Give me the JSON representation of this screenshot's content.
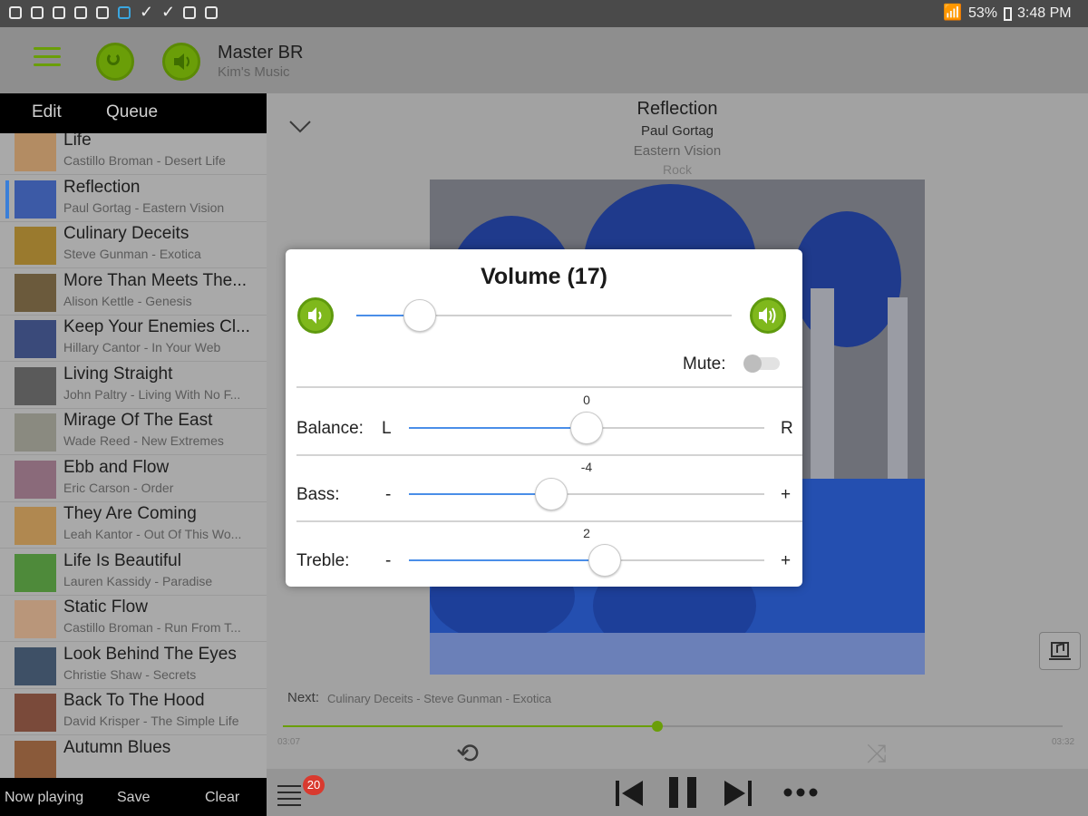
{
  "status_bar": {
    "battery": "53%",
    "time": "3:48 PM"
  },
  "header": {
    "title": "Master BR",
    "subtitle": "Kim's Music"
  },
  "left_panel": {
    "tabs": [
      "Edit",
      "Queue"
    ],
    "tracks": [
      {
        "title": "Life",
        "subtitle": "Castillo Broman - Desert Life",
        "thumb": "#b38c63"
      },
      {
        "title": "Reflection",
        "subtitle": "Paul Gortag - Eastern Vision",
        "thumb": "#3c5aa6",
        "active": true
      },
      {
        "title": "Culinary Deceits",
        "subtitle": "Steve Gunman - Exotica",
        "thumb": "#9a7a2e"
      },
      {
        "title": "More Than Meets The...",
        "subtitle": "Alison Kettle - Genesis",
        "thumb": "#6b5a3c"
      },
      {
        "title": "Keep Your Enemies Cl...",
        "subtitle": "Hillary Cantor - In Your Web",
        "thumb": "#3a4a7a"
      },
      {
        "title": "Living Straight",
        "subtitle": "John Paltry - Living With No F...",
        "thumb": "#5a5a5a"
      },
      {
        "title": "Mirage Of The East",
        "subtitle": "Wade Reed - New Extremes",
        "thumb": "#8a8a80"
      },
      {
        "title": "Ebb and Flow",
        "subtitle": "Eric Carson - Order",
        "thumb": "#8a6a7a"
      },
      {
        "title": "They Are Coming",
        "subtitle": "Leah Kantor - Out Of This Wo...",
        "thumb": "#b08850"
      },
      {
        "title": "Life Is Beautiful",
        "subtitle": "Lauren Kassidy - Paradise",
        "thumb": "#4e8a3a"
      },
      {
        "title": "Static Flow",
        "subtitle": "Castillo Broman - Run From T...",
        "thumb": "#b9967a"
      },
      {
        "title": "Look Behind The Eyes",
        "subtitle": "Christie Shaw - Secrets",
        "thumb": "#3e5066"
      },
      {
        "title": "Back To The Hood",
        "subtitle": "David Krisper - The Simple Life",
        "thumb": "#7a4a3a"
      },
      {
        "title": "Autumn Blues",
        "subtitle": "",
        "thumb": "#8a5a3a"
      }
    ],
    "footer": [
      "Now playing",
      "Save",
      "Clear"
    ]
  },
  "now_playing": {
    "title": "Reflection",
    "artist": "Paul Gortag",
    "album": "Eastern Vision",
    "genre": "Rock",
    "next_label": "Next:",
    "next_track": "Culinary Deceits - Steve Gunman - Exotica",
    "elapsed": "03:07",
    "total": "03:32",
    "progress": 0.48,
    "queue_count": "20"
  },
  "volume_dialog": {
    "title": "Volume (17)",
    "volume": 17,
    "mute_label": "Mute:",
    "mute_on": false,
    "balance": {
      "label": "Balance:",
      "min": "L",
      "max": "R",
      "value": "0",
      "pos": 0.5
    },
    "bass": {
      "label": "Bass:",
      "min": "-",
      "max": "+",
      "value": "-4",
      "pos": 0.4
    },
    "treble": {
      "label": "Treble:",
      "min": "-",
      "max": "+",
      "value": "2",
      "pos": 0.55
    }
  },
  "colors": {
    "accent_green": "#7fb81c",
    "slider_blue": "#4a8ee8",
    "badge_red": "#d93a2f"
  }
}
